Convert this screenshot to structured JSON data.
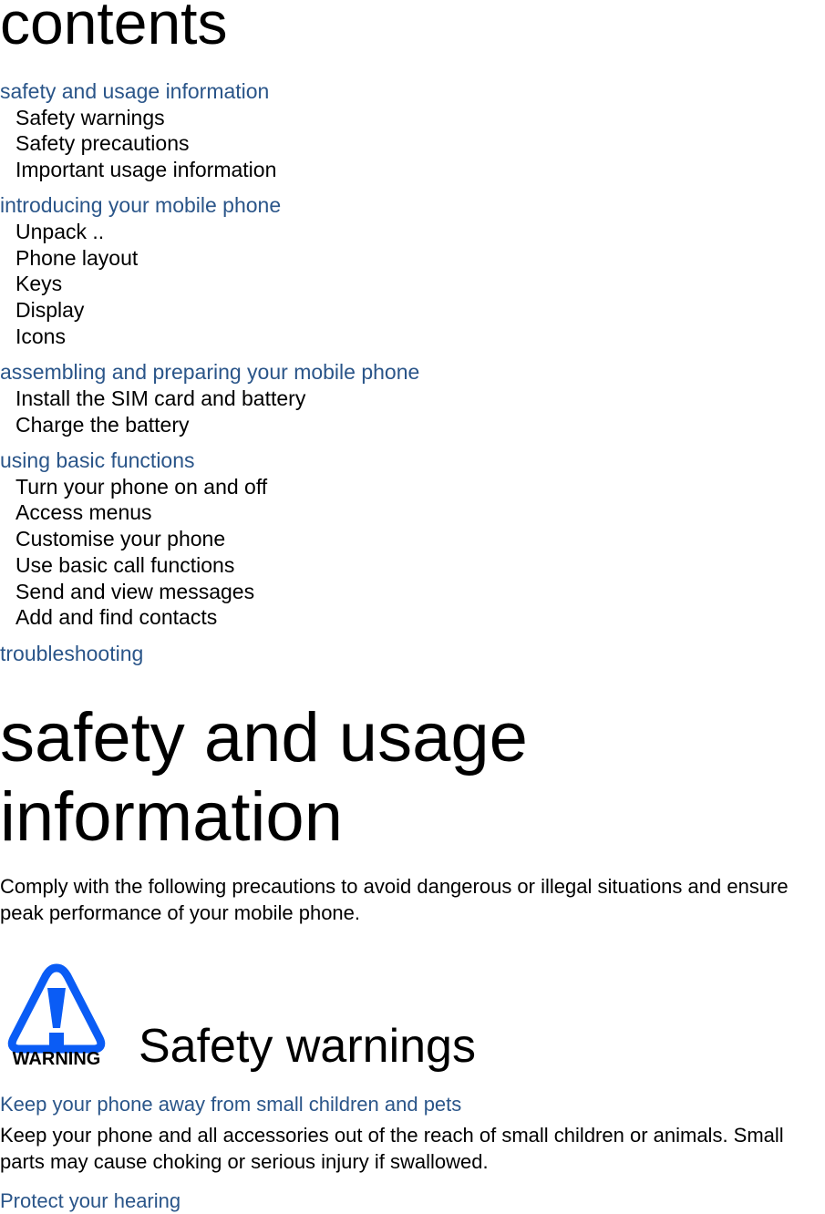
{
  "contents": {
    "title": "contents",
    "sections": [
      {
        "label": "safety and usage information",
        "items": [
          "Safety warnings",
          "Safety precautions",
          "Important usage information"
        ]
      },
      {
        "label": "introducing your mobile phone",
        "items": [
          "Unpack  ..",
          "Phone layout",
          "Keys",
          "Display",
          "Icons"
        ]
      },
      {
        "label": "assembling and preparing your mobile phone",
        "items": [
          "Install the SIM card and battery",
          "Charge the battery"
        ]
      },
      {
        "label": "using basic functions",
        "items": [
          "Turn your phone on and off",
          "Access menus",
          "Customise your phone",
          "Use basic call functions",
          "Send and view messages",
          "Add and find contacts"
        ]
      },
      {
        "label": "troubleshooting",
        "items": []
      }
    ]
  },
  "chapter": {
    "title_line1": "safety and usage",
    "title_line2": "information",
    "intro": "Comply with the following precautions to avoid dangerous or illegal situations and ensure peak performance of your mobile phone."
  },
  "warnings": {
    "icon_label": "WARNING",
    "heading": "Safety warnings",
    "icon_color": "#0a5cf5",
    "items": [
      {
        "title": "Keep your phone away from small children and pets",
        "body": "Keep your phone and all accessories out of the reach of small children or animals. Small parts may cause choking or serious injury if swallowed."
      },
      {
        "title": "Protect your hearing",
        "body": ""
      }
    ]
  }
}
